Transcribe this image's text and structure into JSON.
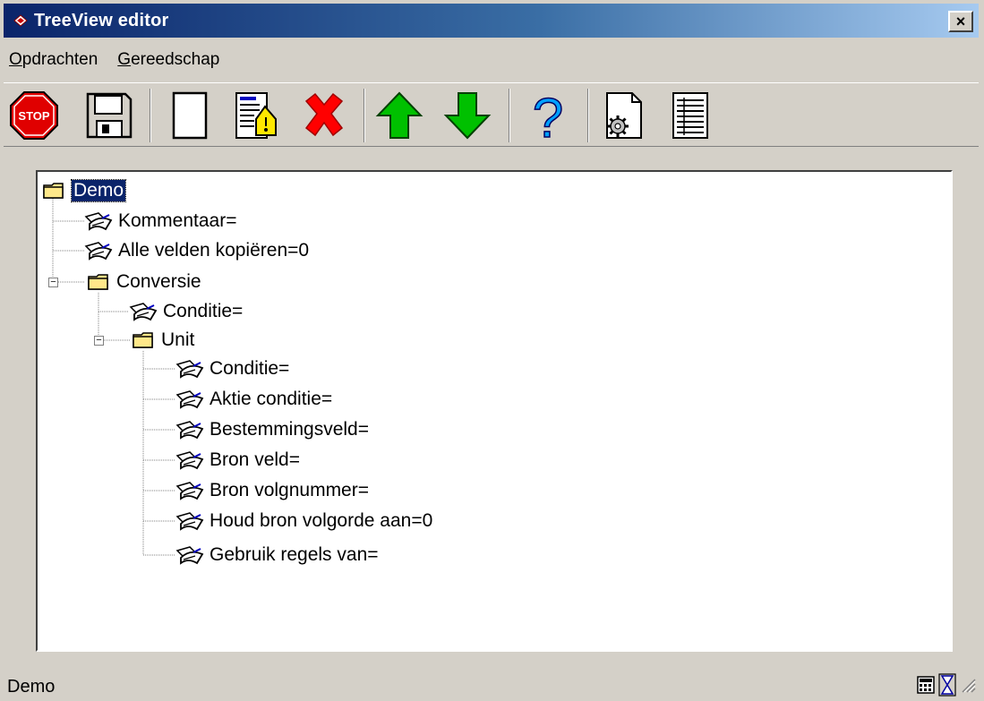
{
  "window": {
    "title": "TreeView editor",
    "close_label": "×"
  },
  "menu": {
    "items": [
      {
        "mnemonic": "O",
        "rest": "pdrachten"
      },
      {
        "mnemonic": "G",
        "rest": "ereedschap"
      }
    ]
  },
  "toolbar": {
    "buttons": [
      {
        "icon": "stop-icon",
        "text": "STOP"
      },
      {
        "icon": "save-disk-icon"
      },
      {
        "icon": "new-document-icon"
      },
      {
        "icon": "edit-document-icon"
      },
      {
        "icon": "delete-x-icon"
      },
      {
        "icon": "arrow-up-icon"
      },
      {
        "icon": "arrow-down-icon"
      },
      {
        "icon": "help-question-icon",
        "text": "?"
      },
      {
        "icon": "settings-document-icon"
      },
      {
        "icon": "list-document-icon"
      }
    ]
  },
  "tree": {
    "nodes": [
      {
        "label": "Demo",
        "type": "folder",
        "selected": true
      },
      {
        "label": "Kommentaar=",
        "type": "item"
      },
      {
        "label": "Alle velden kopiëren=0",
        "type": "item"
      },
      {
        "label": "Conversie",
        "type": "folder",
        "expanded": true
      },
      {
        "label": "Conditie=",
        "type": "item"
      },
      {
        "label": "Unit",
        "type": "folder",
        "expanded": true
      },
      {
        "label": "Conditie=",
        "type": "item"
      },
      {
        "label": "Aktie conditie=",
        "type": "item"
      },
      {
        "label": "Bestemmingsveld=",
        "type": "item"
      },
      {
        "label": "Bron veld=",
        "type": "item"
      },
      {
        "label": "Bron volgnummer=",
        "type": "item"
      },
      {
        "label": "Houd bron volgorde aan=0",
        "type": "item"
      },
      {
        "label": "Gebruik regels van=",
        "type": "item"
      }
    ]
  },
  "status": {
    "text": "Demo"
  },
  "colors": {
    "selection": "#0a246a",
    "titlebar_start": "#0a246a",
    "titlebar_end": "#a6caf0",
    "face": "#d4d0c8"
  }
}
